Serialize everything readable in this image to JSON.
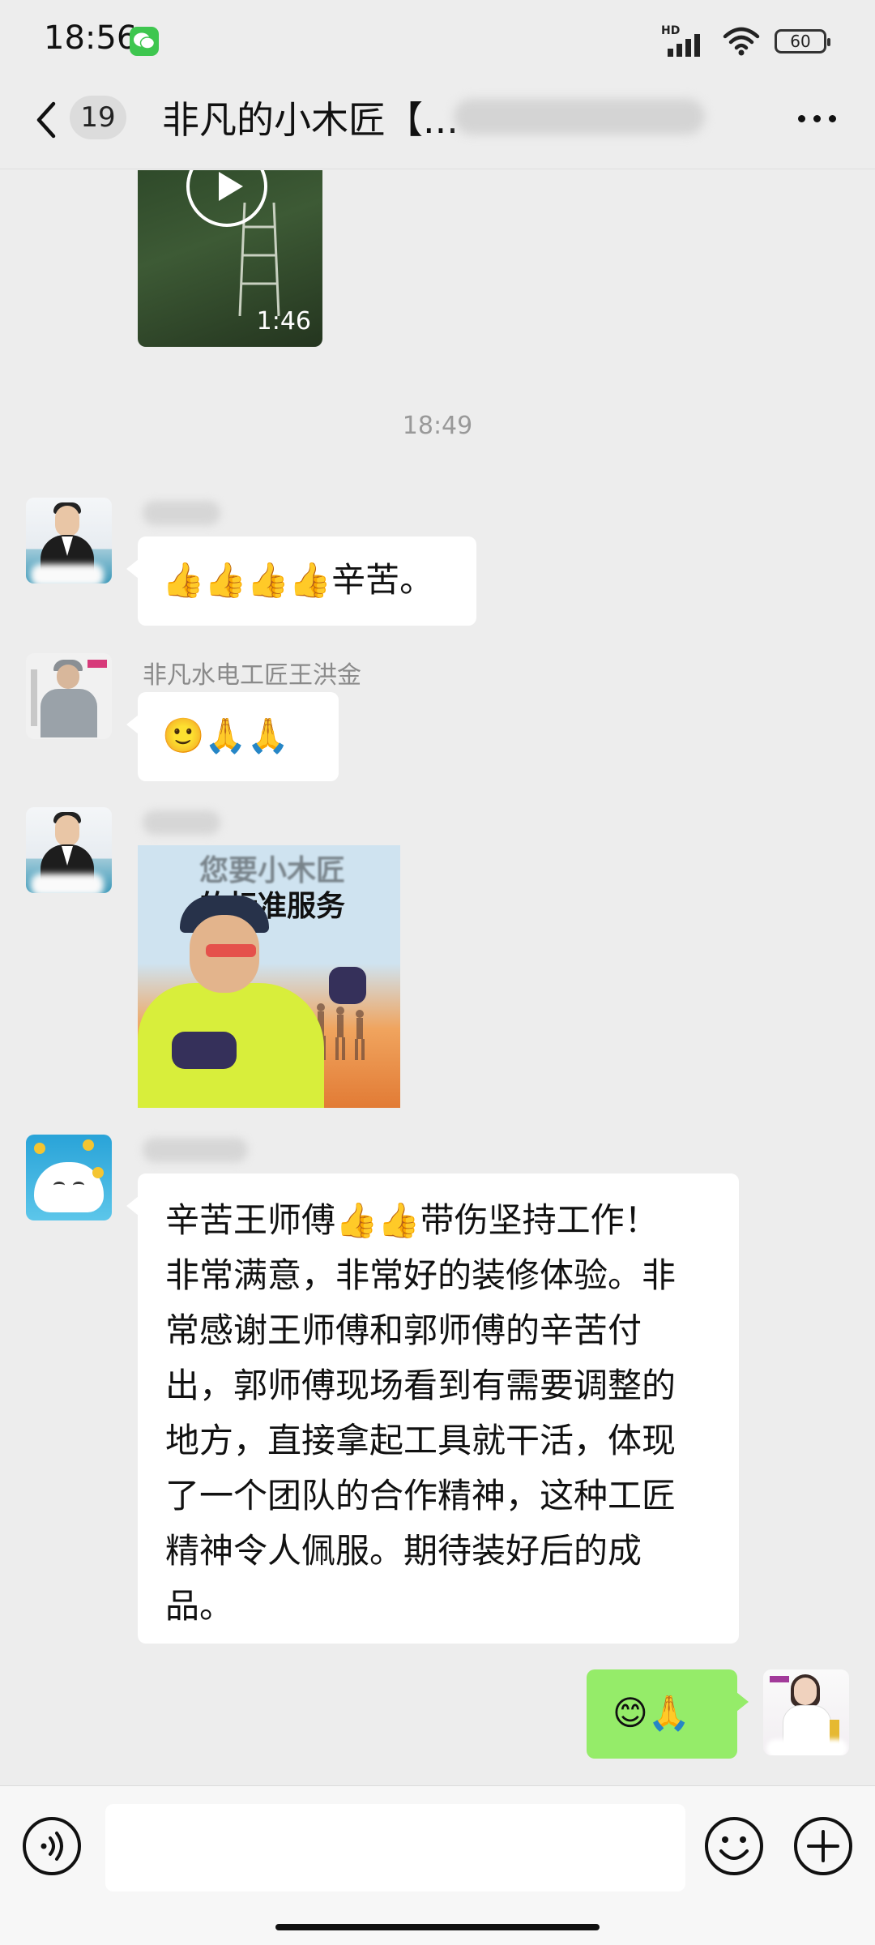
{
  "status_bar": {
    "time": "18:56",
    "network_label": "HD",
    "battery_level": "60",
    "icons": [
      "wechat-notification-icon",
      "hd-signal-icon",
      "wifi-icon",
      "battery-icon"
    ]
  },
  "header": {
    "unread_count": "19",
    "title": "非凡的小木匠【...",
    "icons": [
      "chevron-left-icon",
      "more-dots-icon"
    ]
  },
  "video_message": {
    "duration": "1:46",
    "icons": [
      "play-icon"
    ]
  },
  "time_divider": "18:49",
  "messages": [
    {
      "sender": "",
      "text": "👍👍👍👍辛苦。"
    },
    {
      "sender": "非凡水电工匠王洪金",
      "text": "🙂🙏🙏"
    },
    {
      "sender": "",
      "sticker_text": [
        "您要小木匠",
        "的标准服务"
      ]
    },
    {
      "sender": "",
      "text": "辛苦王师傅👍👍带伤坚持工作！\n非常满意，非常好的装修体验。非\n常感谢王师傅和郭师傅的辛苦付\n出，郭师傅现场看到有需要调整的\n地方，直接拿起工具就干活，体现\n了一个团队的合作精神，这种工匠\n精神令人佩服。期待装好后的成\n品。"
    },
    {
      "sender": "me",
      "text": "😊🙏"
    }
  ],
  "input_bar": {
    "placeholder": "",
    "icons": [
      "voice-icon",
      "emoji-icon",
      "plus-icon"
    ]
  },
  "colors": {
    "background": "#ededed",
    "bubble_incoming": "#ffffff",
    "bubble_outgoing": "#95ec69",
    "wechat_green": "#3ec64f"
  }
}
